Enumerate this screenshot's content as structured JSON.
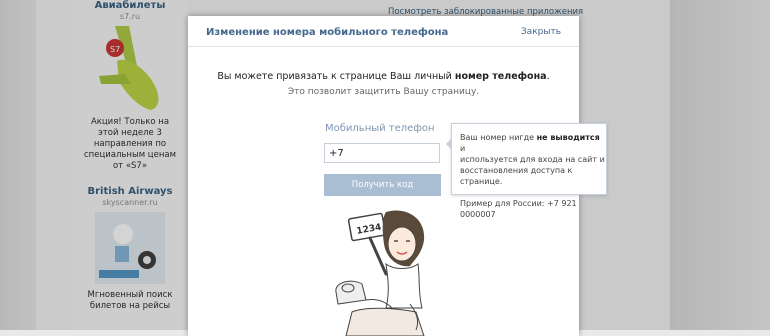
{
  "background": {
    "top_link": "Посмотреть заблокированные приложения",
    "ads": [
      {
        "title": "Авиабилеты",
        "domain": "s7.ru",
        "text": "Акция! Только на этой неделе 3 направления по специальным ценам от «S7»"
      },
      {
        "title": "British Airways",
        "domain": "skyscanner.ru",
        "text": "Мгновенный поиск билетов на рейсы"
      }
    ]
  },
  "modal": {
    "title": "Изменение номера мобильного телефона",
    "close_label": "Закрыть",
    "intro_prefix": "Вы можете привязать к странице Ваш личный",
    "intro_bold": "номер телефона",
    "intro_suffix": ".",
    "intro_line2": "Это позволит защитить Вашу страницу.",
    "field_label": "Мобильный телефон",
    "phone_value": "+7",
    "submit_label": "Получить код"
  },
  "tooltip": {
    "line1_prefix": "Ваш номер нигде",
    "line1_bold": "не выводится",
    "line1_suffix": "и",
    "line2": "используется для входа на сайт и",
    "line3": "восстановления доступа к странице.",
    "example": "Пример для России: +7 921 0000007"
  },
  "illustration": {
    "code_card": "1234"
  },
  "colors": {
    "link": "#45688e",
    "button": "#a9bed3",
    "label": "#7e97b4"
  }
}
